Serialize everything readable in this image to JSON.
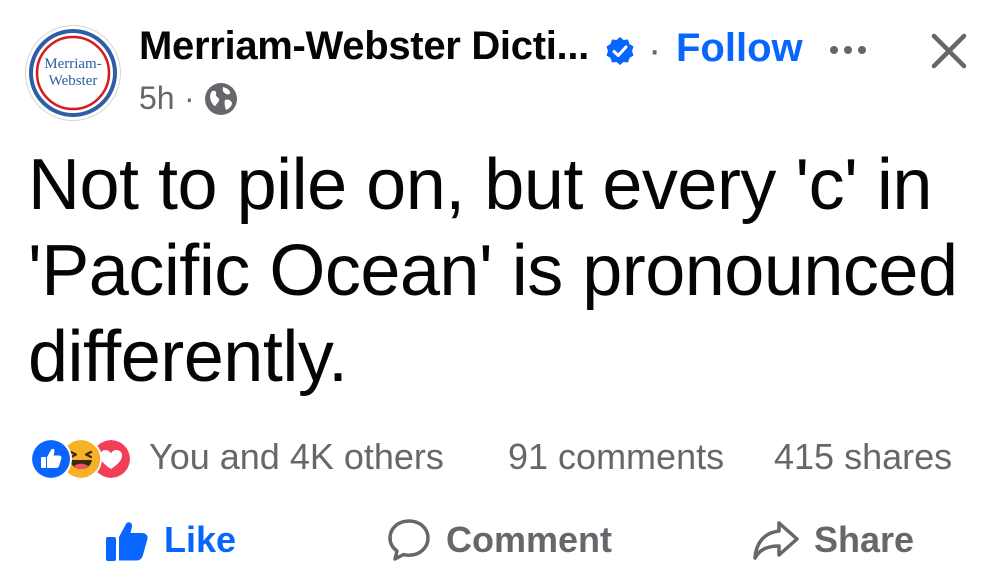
{
  "header": {
    "avatar_label_line1": "Merriam-",
    "avatar_label_line2": "Webster",
    "page_name": "Merriam-Webster Dicti...",
    "separator": "·",
    "follow_label": "Follow",
    "time": "5h",
    "time_separator": "·",
    "audience_icon": "globe-icon",
    "more_icon": "more-horizontal-icon",
    "close_icon": "close-icon"
  },
  "post": {
    "text": "Not to pile on, but every 'c' in 'Pacific Ocean' is pronounced differently."
  },
  "engagement": {
    "reactions": [
      "like-reaction-icon",
      "haha-reaction-icon",
      "love-reaction-icon"
    ],
    "reaction_summary": "You and 4K others",
    "comments": "91 comments",
    "shares": "415 shares"
  },
  "actions": {
    "like_label": "Like",
    "comment_label": "Comment",
    "share_label": "Share"
  },
  "colors": {
    "accent": "#0866ff",
    "secondary_text": "#65676b",
    "primary_text": "#050505",
    "brand_blue": "#2d5ea6",
    "brand_red": "#d71920",
    "love_red": "#f33e58",
    "haha_yellow": "#f7b125"
  }
}
